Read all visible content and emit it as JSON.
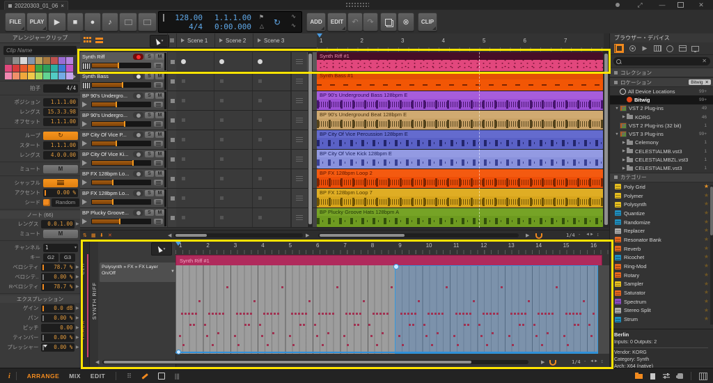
{
  "titlebar": {
    "tab_title": "20220303_01_06",
    "close": "×"
  },
  "transport": {
    "file": "FILE",
    "play_menu": "PLAY",
    "add": "ADD",
    "edit": "EDIT",
    "clip": "CLIP",
    "display": {
      "tempo": "128.00",
      "signature": "4/4",
      "position": "1.1.1.00",
      "time": "0:00.000"
    }
  },
  "inspector": {
    "title": "アレンジャークリップ",
    "clip_name_placeholder": "Clip Name",
    "palette": [
      "#4f4f4f",
      "#8f8f8f",
      "#d8d8d8",
      "#8495ab",
      "#bfa15c",
      "#aa7a3e",
      "#c0524f",
      "#9a6bd4",
      "#b583e2",
      "#e0487c",
      "#d83c3c",
      "#e85a2c",
      "#f07c1e",
      "#3fa83f",
      "#2ba05c",
      "#2bb0a2",
      "#3a7ad8",
      "#c455c8",
      "#f088b0",
      "#f0906a",
      "#f0a83c",
      "#f0c84a",
      "#a8d860",
      "#62d492",
      "#52ccc4",
      "#74aae4",
      "#c4a4ec"
    ],
    "groups": [
      {
        "rows": [
          {
            "label": "拍子",
            "value": "4/4",
            "cls": "white"
          }
        ]
      },
      {
        "rows": [
          {
            "label": "ポジション",
            "value": "1.1.1.00"
          },
          {
            "label": "レングス",
            "value": "15.3.3.98"
          },
          {
            "label": "オフセット",
            "value": "1.1.1.00"
          }
        ]
      },
      {
        "rows": [
          {
            "label": "ループ",
            "widget": "loop"
          },
          {
            "label": "スタート",
            "value": "1.1.1.00"
          },
          {
            "label": "レングス",
            "value": "4.0.0.00"
          }
        ]
      },
      {
        "rows": [
          {
            "label": "ミュート",
            "widget": "mute",
            "value": "M"
          }
        ]
      },
      {
        "rows": [
          {
            "label": "シャッフル",
            "widget": "shuffle"
          },
          {
            "label": "アクセント",
            "value": "0.00 %",
            "tick": "on"
          },
          {
            "label": "シード",
            "widget": "seed",
            "value": "Random"
          }
        ]
      },
      {
        "header": "ノート (66)",
        "rows": [
          {
            "label": "レングス",
            "value": "0.0.1.00",
            "exp": true
          },
          {
            "label": "ミュート",
            "widget": "mute",
            "value": "M"
          }
        ]
      },
      {
        "rows": [
          {
            "label": "チャンネル",
            "widget": "select",
            "value": "1"
          },
          {
            "label": "キー",
            "widget": "pair",
            "values": [
              "G2",
              "G3"
            ]
          },
          {
            "label": "ベロシティ",
            "value": "78.7 %",
            "tick": "on",
            "exp": true
          },
          {
            "label": "ベロシテ..",
            "value": "0.00 %",
            "tick": "off",
            "exp": true
          },
          {
            "label": "Rベロシティ",
            "value": "78.7 %",
            "tick": "on",
            "exp": true
          }
        ]
      },
      {
        "header": "エクスプレッション",
        "rows": [
          {
            "label": "ゲイン",
            "value": "0.0 dB",
            "tick": "on",
            "exp": true
          },
          {
            "label": "パン",
            "value": "0.00 %",
            "tick": "off",
            "exp": true
          },
          {
            "label": "ピッチ",
            "value": "0.00",
            "exp": true
          },
          {
            "label": "ティンバー",
            "value": "0.00 %",
            "tick": "off",
            "exp": true
          },
          {
            "label": "プレッシャー",
            "value": "0.00 %",
            "tick": "off",
            "exp": true,
            "marker": true
          }
        ]
      }
    ]
  },
  "launcher": {
    "solo": "S",
    "mute": "M",
    "scenes": [
      "Scene 1",
      "Scene 2",
      "Scene 3"
    ],
    "tracks": [
      {
        "name": "Synth Riff",
        "type": "instrument",
        "armed": true,
        "selected": true,
        "level": 45,
        "slot": "dot"
      },
      {
        "name": "Synth Bass",
        "type": "instrument",
        "armed": false,
        "white_arm": true,
        "level": 52,
        "slot": "sq"
      },
      {
        "name": "BP 90's Undergro...",
        "type": "audio",
        "level": 42,
        "slot": "sq"
      },
      {
        "name": "BP 90's Undergro...",
        "type": "audio",
        "level": 56,
        "slot": "sq"
      },
      {
        "name": "BP City Of Vice P...",
        "type": "audio",
        "level": 42,
        "slot": "sq"
      },
      {
        "name": "BP City Of Vice Ki...",
        "type": "audio",
        "level": 70,
        "slot": "sq"
      },
      {
        "name": "BP FX 128bpm Lo...",
        "type": "audio",
        "level": 36,
        "slot": "sq"
      },
      {
        "name": "BP FX 128bpm Lo...",
        "type": "audio",
        "level": 36,
        "slot": "sq"
      },
      {
        "name": "BP Plucky Groove...",
        "type": "audio",
        "level": 48,
        "slot": "sq"
      }
    ]
  },
  "arranger": {
    "ruler": [
      "1",
      "2",
      "3",
      "4",
      "5",
      "6",
      "7"
    ],
    "snap": "1/4",
    "clips": [
      {
        "name": "Synth Riff #1",
        "body": "#e2477d",
        "head": "#470d27",
        "text": "#e98bb0",
        "pattern": "dots",
        "ink": "#6d1030"
      },
      {
        "name": "Synth Bass #1",
        "body": "#f25605",
        "head": "#e44f04",
        "text": "#651501",
        "pattern": "dash",
        "ink": "#7c2400"
      },
      {
        "name": "BP 90's Underground Bass 128bpm E",
        "body": "#9c50d4",
        "head": "#a75ddb",
        "text": "#300a5c",
        "pattern": "wave",
        "ink": "#47156e"
      },
      {
        "name": "BP 90's Underground Beat 128bpm E",
        "body": "#c9a267",
        "head": "#d0aa71",
        "text": "#4b3310",
        "pattern": "wave",
        "ink": "#54431c"
      },
      {
        "name": "BP City Of Vice Percussion 128bpm E",
        "body": "#5a61c6",
        "head": "#646bce",
        "text": "#101448",
        "pattern": "tri",
        "ink": "#23266c"
      },
      {
        "name": "BP City Of Vice Kick 128bpm E",
        "body": "#8991dc",
        "head": "#939ae2",
        "text": "#1c2260",
        "pattern": "tri",
        "ink": "#3a4194"
      },
      {
        "name": "BP FX 128bpm Loop 2",
        "body": "#ef4f08",
        "head": "#f45a10",
        "text": "#5c1500",
        "pattern": "wave",
        "ink": "#7e2502"
      },
      {
        "name": "BP FX 128bpm Loop 7",
        "body": "#d8a51c",
        "head": "#dfad24",
        "text": "#4f3a02",
        "pattern": "wave",
        "ink": "#6d5305"
      },
      {
        "name": "BP Plucky Groove Hats 128bpm A",
        "body": "#6e9b20",
        "head": "#76a326",
        "text": "#24380a",
        "pattern": "tri",
        "ink": "#32500c"
      }
    ]
  },
  "editor": {
    "tabs": {
      "clip": "CLIP",
      "track": "TRACK"
    },
    "track_label": "SYNTH RIFF",
    "device_path": "Polysynth » FX » FX Layer",
    "device_param": "On/Off",
    "clip_title": "Synth Riff #1",
    "ruler": [
      "1",
      "2",
      "3",
      "4",
      "5",
      "6",
      "7",
      "8",
      "9",
      "10",
      "11",
      "12",
      "13",
      "14",
      "15",
      "16"
    ],
    "snap": "1/4"
  },
  "browser": {
    "title": "ブラウザー・デバイス",
    "sections": {
      "collections": "コレクション",
      "locations": "ロケーション",
      "categories": "カテゴリー"
    },
    "filter_tag": "Bitwig",
    "locations": [
      {
        "name": "All Device Locations",
        "count": "99+",
        "icon": "circle",
        "indent": 0,
        "expander": ""
      },
      {
        "name": "Bitwig",
        "count": "99+",
        "icon": "bitwig",
        "indent": 1,
        "expander": "",
        "selected": true
      },
      {
        "name": "VST 2 Plug-ins",
        "count": "49",
        "icon": "plug",
        "indent": 0,
        "expander": "▼"
      },
      {
        "name": "KORG",
        "count": "46",
        "icon": "folder",
        "indent": 1,
        "expander": "▶"
      },
      {
        "name": "VST 2 Plug-ins (32 bit)",
        "count": "1",
        "icon": "plug",
        "indent": 0,
        "expander": ""
      },
      {
        "name": "VST 3 Plug-ins",
        "count": "99+",
        "icon": "plug",
        "indent": 0,
        "expander": "▼"
      },
      {
        "name": "Celemony",
        "count": "1",
        "icon": "folder",
        "indent": 1,
        "expander": "▶"
      },
      {
        "name": "CELESTIALMB.vst3",
        "count": "1",
        "icon": "folder",
        "indent": 1,
        "expander": "▶"
      },
      {
        "name": "CELESTIALMBZL.vst3",
        "count": "1",
        "icon": "folder",
        "indent": 1,
        "expander": "▶"
      },
      {
        "name": "CELESTIALME.vst3",
        "count": "1",
        "icon": "folder",
        "indent": 1,
        "expander": "▶"
      }
    ],
    "categories": [
      {
        "name": "Poly Grid",
        "color": "#e8c020",
        "starred": true
      },
      {
        "name": "Polymer",
        "color": "#e8c020"
      },
      {
        "name": "Polysynth",
        "color": "#e8c020"
      },
      {
        "name": "Quantize",
        "color": "#2090c0"
      },
      {
        "name": "Randomize",
        "color": "#2090c0"
      },
      {
        "name": "Replacer",
        "color": "#b0b0b0"
      },
      {
        "name": "Resonator Bank",
        "color": "#e86820"
      },
      {
        "name": "Reverb",
        "color": "#e86820"
      },
      {
        "name": "Ricochet",
        "color": "#2090c0"
      },
      {
        "name": "Ring-Mod",
        "color": "#e86820"
      },
      {
        "name": "Rotary",
        "color": "#e86820"
      },
      {
        "name": "Sampler",
        "color": "#e8c020"
      },
      {
        "name": "Saturator",
        "color": "#e86820"
      },
      {
        "name": "Spectrum",
        "color": "#9050c8"
      },
      {
        "name": "Stereo Split",
        "color": "#b0b0b0"
      },
      {
        "name": "Strum",
        "color": "#2090c0"
      }
    ],
    "device_info": {
      "name": "Berlin",
      "io": "Inputs: 0   Outputs: 2",
      "vendor": "Vendor: KORG",
      "category": "Category: Synth",
      "arch": "Arch: X64 (native)"
    }
  },
  "statusbar": {
    "info": "i",
    "arrange": "ARRANGE",
    "mix": "MIX",
    "edit": "EDIT"
  },
  "colors": {
    "accent": "#f28a1e",
    "selection_blue": "#4a9ade",
    "annotation": "#ffe400",
    "playhead": "#4a9ade"
  }
}
